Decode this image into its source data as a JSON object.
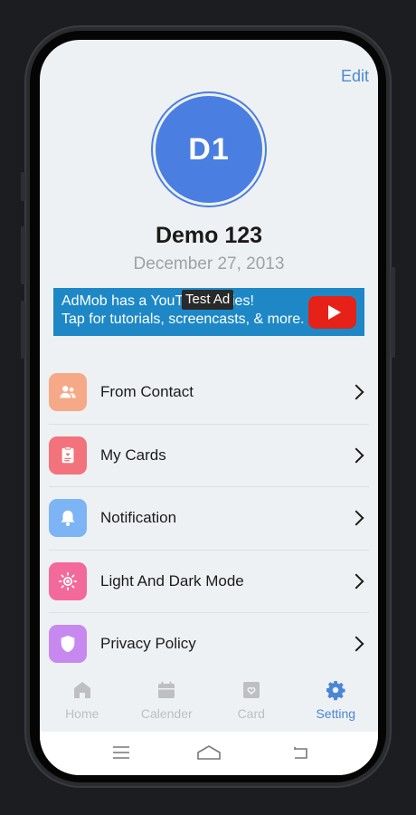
{
  "header": {
    "edit_label": "Edit"
  },
  "profile": {
    "initials": "D1",
    "name": "Demo 123",
    "date": "December 27, 2013"
  },
  "ad": {
    "line1": "AdMob has a YouTube series!",
    "line2": "Tap for tutorials, screencasts, & more.",
    "badge": "Test Ad",
    "button_icon": "youtube-play-icon"
  },
  "menu": {
    "items": [
      {
        "label": "From Contact",
        "icon": "contacts-icon",
        "color": "#f6a987"
      },
      {
        "label": "My Cards",
        "icon": "card-heart-icon",
        "color": "#f2737c"
      },
      {
        "label": "Notification",
        "icon": "bell-icon",
        "color": "#7cb4f5"
      },
      {
        "label": "Light And Dark Mode",
        "icon": "sun-icon",
        "color": "#f3699a"
      },
      {
        "label": "Privacy Policy",
        "icon": "shield-icon",
        "color": "#c789ef"
      }
    ]
  },
  "tabs": [
    {
      "label": "Home",
      "icon": "home-icon",
      "active": false
    },
    {
      "label": "Calender",
      "icon": "calendar-icon",
      "active": false
    },
    {
      "label": "Card",
      "icon": "card-icon",
      "active": false
    },
    {
      "label": "Setting",
      "icon": "gear-icon",
      "active": true
    }
  ],
  "navbar": {
    "buttons": [
      "menu-icon",
      "home-outline-icon",
      "back-icon"
    ]
  },
  "colors": {
    "accent": "#4a86d6",
    "avatar": "#4a7ee0",
    "ad_bg": "#1e88c7"
  }
}
